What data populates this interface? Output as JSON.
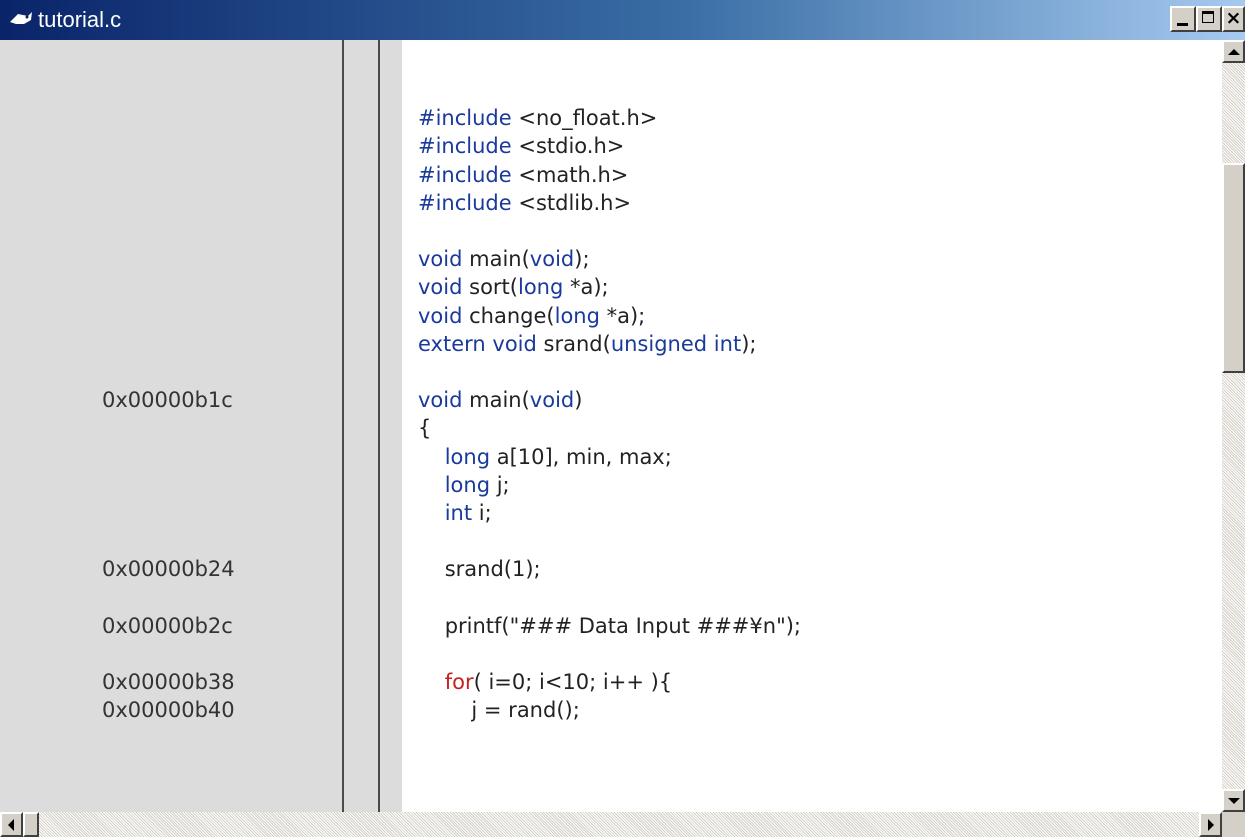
{
  "window": {
    "title": "tutorial.c",
    "controls": {
      "minimize": "minimize",
      "maximize": "maximize",
      "close": "×"
    }
  },
  "lines": [
    {
      "addr": "",
      "code": ""
    },
    {
      "addr": "",
      "code": "#include <no_float.h>"
    },
    {
      "addr": "",
      "code": "#include <stdio.h>"
    },
    {
      "addr": "",
      "code": "#include <math.h>"
    },
    {
      "addr": "",
      "code": "#include <stdlib.h>"
    },
    {
      "addr": "",
      "code": ""
    },
    {
      "addr": "",
      "code": "void main(void);"
    },
    {
      "addr": "",
      "code": "void sort(long *a);"
    },
    {
      "addr": "",
      "code": "void change(long *a);"
    },
    {
      "addr": "",
      "code": "extern void srand(unsigned int);"
    },
    {
      "addr": "",
      "code": ""
    },
    {
      "addr": "0x00000b1c",
      "code": "void main(void)"
    },
    {
      "addr": "",
      "code": "{"
    },
    {
      "addr": "",
      "code": "    long a[10], min, max;"
    },
    {
      "addr": "",
      "code": "    long j;"
    },
    {
      "addr": "",
      "code": "    int i;"
    },
    {
      "addr": "",
      "code": ""
    },
    {
      "addr": "0x00000b24",
      "code": "    srand(1);"
    },
    {
      "addr": "",
      "code": ""
    },
    {
      "addr": "0x00000b2c",
      "code": "    printf(\"### Data Input ###¥n\");"
    },
    {
      "addr": "",
      "code": ""
    },
    {
      "addr": "0x00000b38",
      "code": "    for( i=0; i<10; i++ ){"
    },
    {
      "addr": "0x00000b40",
      "code": "        j = rand();"
    }
  ],
  "colors": {
    "keyword": "#1a3a9c",
    "red_keyword": "#c82020",
    "code_bg": "#ffffff",
    "gutter_bg": "#dcdcdc"
  },
  "icons": {
    "file": "source-file-icon",
    "scroll_up": "arrow-up-icon",
    "scroll_down": "arrow-down-icon",
    "scroll_left": "arrow-left-icon",
    "scroll_right": "arrow-right-icon"
  }
}
